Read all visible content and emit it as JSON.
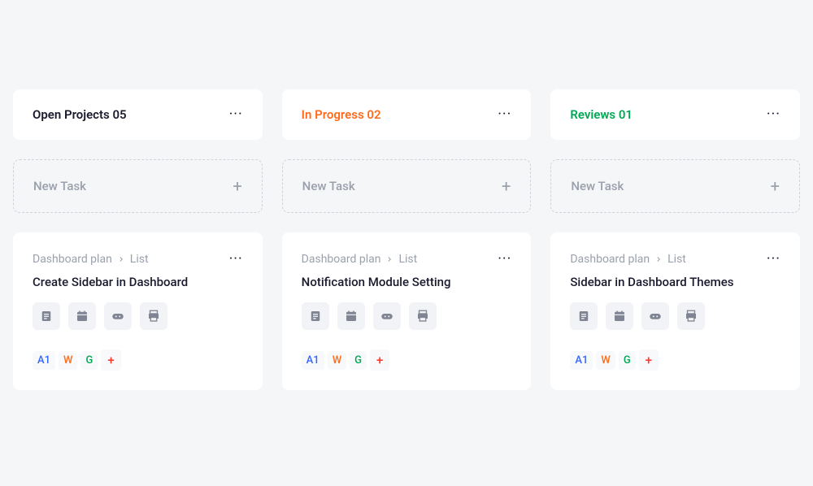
{
  "columns": [
    {
      "title": "Open Projects 05",
      "color_class": "col-title-open",
      "new_task_label": "New Task",
      "card": {
        "breadcrumb_parent": "Dashboard plan",
        "breadcrumb_child": "List",
        "title": "Create Sidebar in Dashboard",
        "badges": {
          "a": "A1",
          "w": "W",
          "g": "G"
        }
      }
    },
    {
      "title": "In Progress 02",
      "color_class": "col-title-progress",
      "new_task_label": "New Task",
      "card": {
        "breadcrumb_parent": "Dashboard plan",
        "breadcrumb_child": "List",
        "title": "Notification Module Setting",
        "badges": {
          "a": "A1",
          "w": "W",
          "g": "G"
        }
      }
    },
    {
      "title": "Reviews 01",
      "color_class": "col-title-reviews",
      "new_task_label": "New Task",
      "card": {
        "breadcrumb_parent": "Dashboard plan",
        "breadcrumb_child": "List",
        "title": "Sidebar in Dashboard Themes",
        "badges": {
          "a": "A1",
          "w": "W",
          "g": "G"
        }
      }
    }
  ],
  "icons": {
    "plus": "+",
    "more": "···",
    "badge_plus": "+"
  }
}
